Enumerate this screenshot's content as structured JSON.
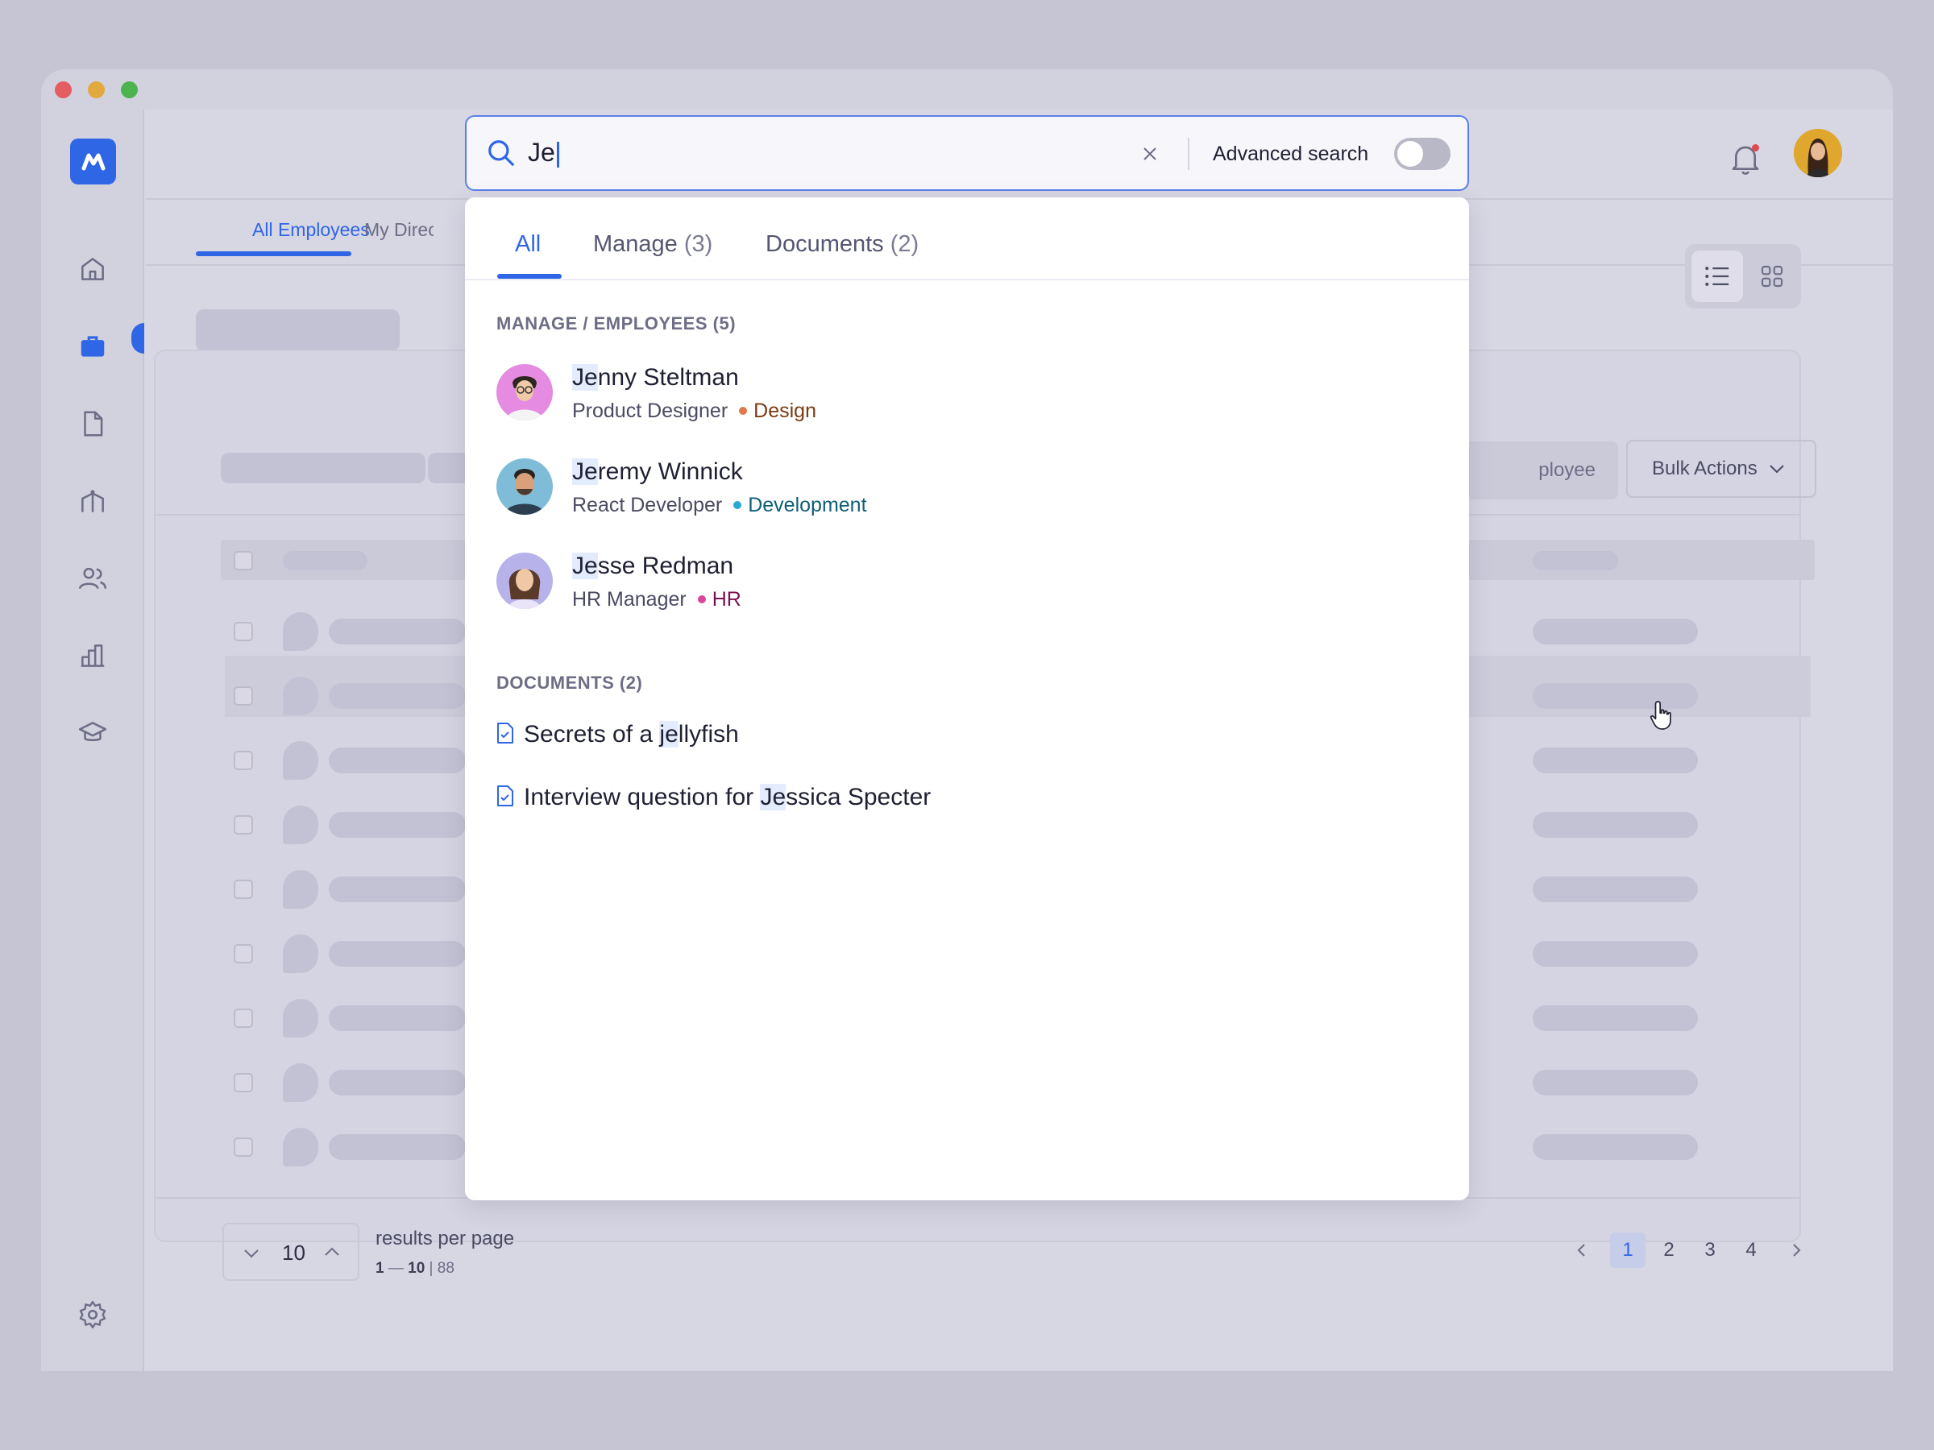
{
  "app": {
    "nav_items": [
      "home-icon",
      "briefcase-icon",
      "document-icon",
      "org-chart-icon",
      "users-icon",
      "bar-chart-icon",
      "graduation-cap-icon"
    ],
    "settings_icon": "gear-icon"
  },
  "page_tabs": [
    {
      "label": "All Employees"
    },
    {
      "label": "My Direct"
    }
  ],
  "search": {
    "query": "Je",
    "advanced_label": "Advanced search",
    "advanced_enabled": false
  },
  "dropdown": {
    "tabs": [
      {
        "label": "All",
        "count": ""
      },
      {
        "label": "Manage",
        "count": "(3)"
      },
      {
        "label": "Documents",
        "count": "(2)"
      }
    ],
    "employees_section": "MANAGE / EMPLOYEES (5)",
    "employees": [
      {
        "match": "Je",
        "rest": "nny Steltman",
        "role": "Product Designer",
        "dept": "Design",
        "dept_color": "#e07a4a",
        "dept_text": "#7a3b12"
      },
      {
        "match": "Je",
        "rest": "remy Winnick",
        "role": "React Developer",
        "dept": "Development",
        "dept_color": "#2ba7d4",
        "dept_text": "#0f5f78"
      },
      {
        "match": "Je",
        "rest": "sse Redman",
        "role": "HR Manager",
        "dept": "HR",
        "dept_color": "#d9469a",
        "dept_text": "#7a1250"
      }
    ],
    "documents_section": "DOCUMENTS (2)",
    "documents": [
      {
        "pre": "Secrets of a ",
        "match": "je",
        "post": "llyfish"
      },
      {
        "pre": "Interview question for ",
        "match": "Je",
        "post": "ssica Specter"
      }
    ]
  },
  "toolbar": {
    "add_employee_partial": "ployee",
    "bulk_actions": "Bulk Actions"
  },
  "footer": {
    "per_page_value": "10",
    "per_page_label": "results per page",
    "range_start": "1",
    "range_sep": " — ",
    "range_end": "10",
    "total_sep": " | ",
    "total": "88",
    "pages": [
      "1",
      "2",
      "3",
      "4"
    ],
    "current_page": "1"
  },
  "colors": {
    "accent": "#2f66e6",
    "highlight": "#e3ecfc"
  }
}
